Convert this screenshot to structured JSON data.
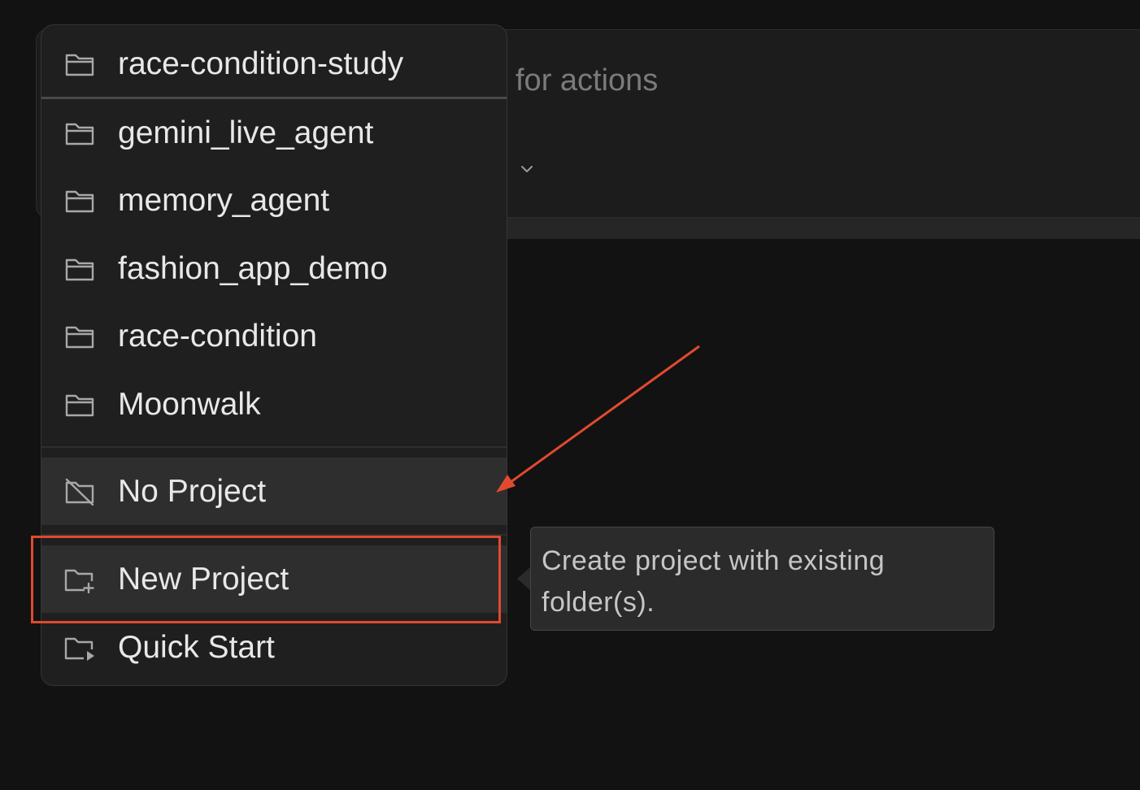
{
  "background": {
    "hint_text": "for actions"
  },
  "menu": {
    "items": [
      {
        "label": "race-condition-study",
        "icon": "folder-icon"
      },
      {
        "label": "gemini_live_agent",
        "icon": "folder-icon"
      },
      {
        "label": "memory_agent",
        "icon": "folder-icon"
      },
      {
        "label": "fashion_app_demo",
        "icon": "folder-icon"
      },
      {
        "label": "race-condition",
        "icon": "folder-icon"
      },
      {
        "label": "Moonwalk",
        "icon": "folder-icon"
      }
    ],
    "no_project": {
      "label": "No Project",
      "icon": "folder-off-icon"
    },
    "new_project": {
      "label": "New Project",
      "icon": "folder-plus-icon"
    },
    "quick_start": {
      "label": "Quick Start",
      "icon": "folder-play-icon"
    }
  },
  "tooltip": {
    "text": "Create project with existing folder(s)."
  },
  "colors": {
    "annotation": "#e04a2f",
    "menu_bg": "#1f1f1f",
    "highlight_bg": "#2e2e2e"
  }
}
